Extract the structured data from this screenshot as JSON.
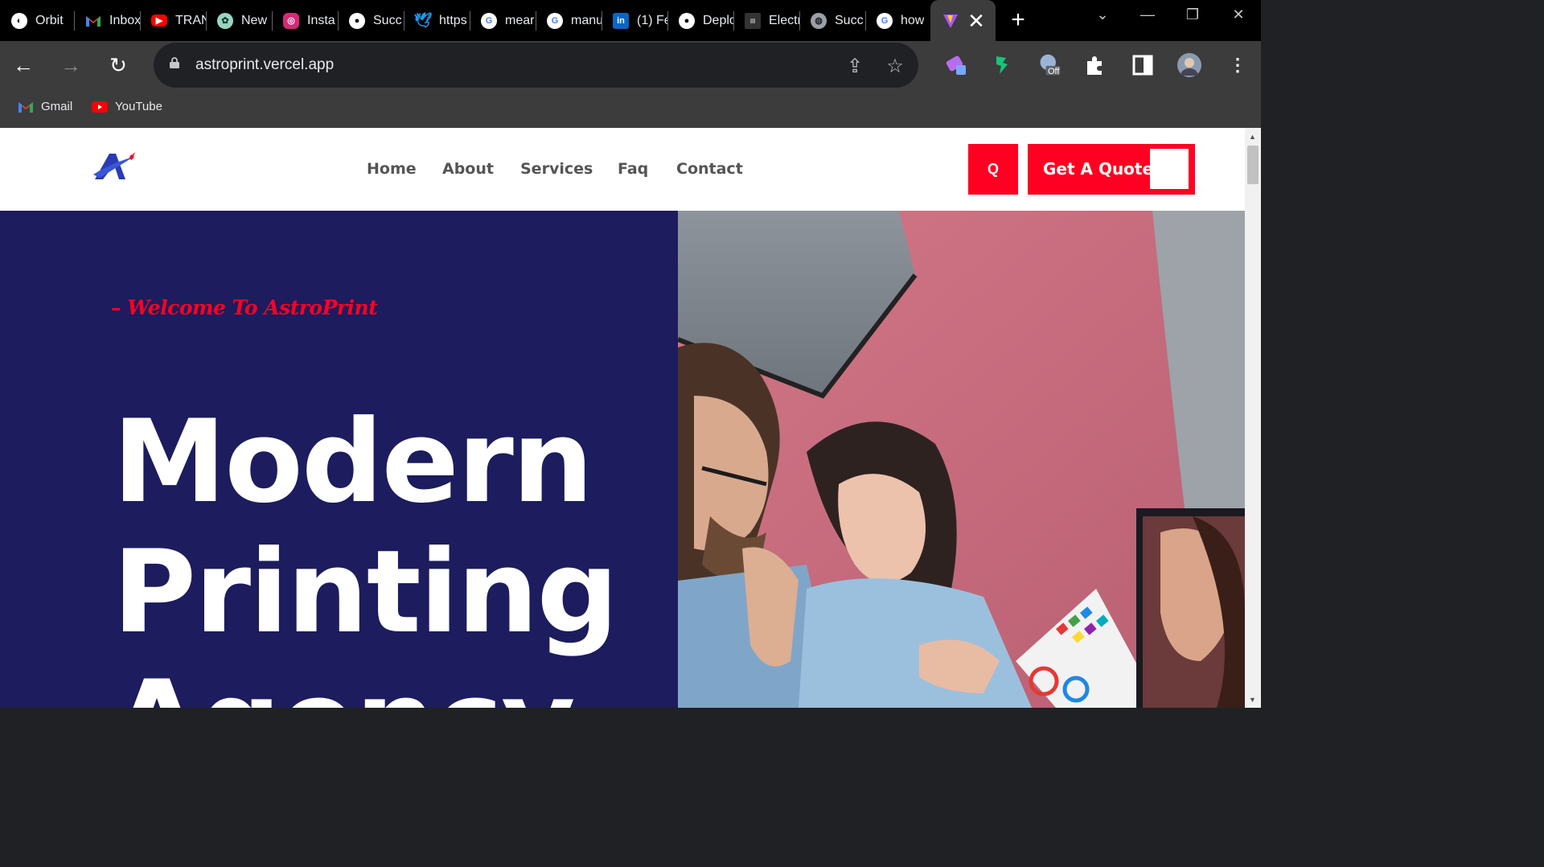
{
  "browser": {
    "tabs": [
      {
        "title": "Orbit",
        "icon": "orbit-icon",
        "color": "#ffffff"
      },
      {
        "title": "Inbox",
        "icon": "gmail-icon",
        "color": "#ea4335"
      },
      {
        "title": "TRAN",
        "icon": "youtube-icon",
        "color": "#ff0000"
      },
      {
        "title": "New",
        "icon": "chatgpt-icon",
        "color": "#10a37f"
      },
      {
        "title": "Insta",
        "icon": "instagram-icon",
        "color": "#e1306c"
      },
      {
        "title": "Succ",
        "icon": "github-icon",
        "color": "#ffffff"
      },
      {
        "title": "https",
        "icon": "twitter-icon",
        "color": "#1d9bf0"
      },
      {
        "title": "mear",
        "icon": "google-icon",
        "color": "#ffffff"
      },
      {
        "title": "manu",
        "icon": "google-icon",
        "color": "#ffffff"
      },
      {
        "title": "(1) Fe",
        "icon": "linkedin-icon",
        "color": "#0a66c2"
      },
      {
        "title": "Deplo",
        "icon": "github-icon",
        "color": "#ffffff"
      },
      {
        "title": "Electr",
        "icon": "logos-icon",
        "color": "#888888"
      },
      {
        "title": "Succ",
        "icon": "globe-icon",
        "color": "#9aa0a6"
      },
      {
        "title": "how",
        "icon": "google-icon",
        "color": "#ffffff"
      }
    ],
    "active_tab_icon": "vite-icon",
    "url": "astroprint.vercel.app",
    "bookmarks": [
      {
        "label": "Gmail",
        "icon": "gmail-icon"
      },
      {
        "label": "YouTube",
        "icon": "youtube-icon"
      }
    ],
    "extension_badge": "Off"
  },
  "site": {
    "nav": [
      "Home",
      "About",
      "Services",
      "Faq",
      "Contact"
    ],
    "search_label": "Q",
    "quote_label": "Get A Quote",
    "welcome": "– Welcome To AstroPrint",
    "hero_lines": [
      "Modern",
      "Printing",
      "Agency"
    ],
    "colors": {
      "brand_red": "#ff0022",
      "hero_navy": "#1c1c5e"
    }
  }
}
